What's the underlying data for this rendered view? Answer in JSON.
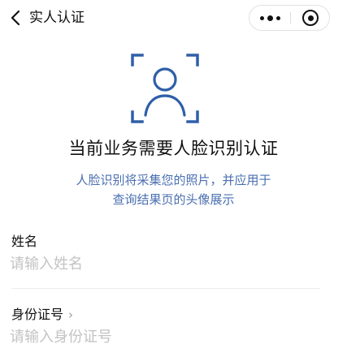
{
  "nav": {
    "title": "实人认证",
    "back_icon": "chevron-left-icon",
    "more_icon": "more-dots-icon",
    "close_icon": "target-circle-icon"
  },
  "face_icon": "face-scan-icon",
  "main": {
    "heading": "当前业务需要人脸识别认证",
    "description_line1": "人脸识别将采集您的照片，并应用于",
    "description_line2": "查询结果页的头像展示"
  },
  "form": {
    "name_label": "姓名",
    "name_placeholder": "请输入姓名",
    "id_label": "身份证号",
    "id_chevron": "›",
    "id_placeholder": "请输入身份证号"
  },
  "colors": {
    "description": "#4a6fb0",
    "placeholder": "#c3c3c3",
    "text": "#111111"
  }
}
